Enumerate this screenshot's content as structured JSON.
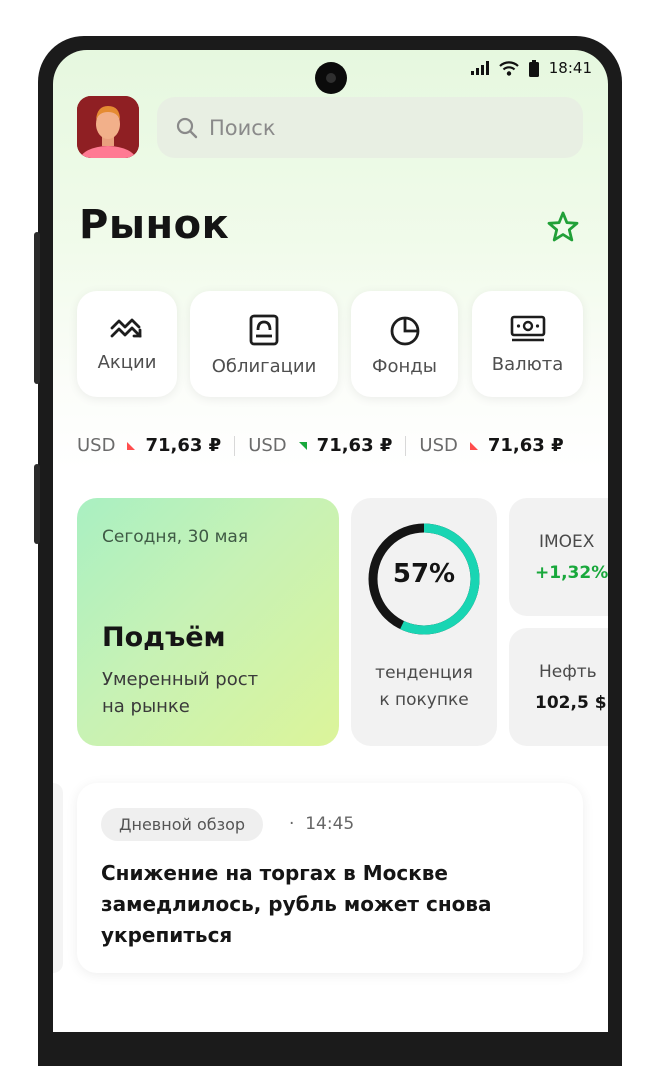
{
  "status_bar": {
    "time": "18:41",
    "icons": [
      "signal-icon",
      "wifi-icon",
      "battery-icon"
    ]
  },
  "search": {
    "placeholder": "Поиск"
  },
  "page": {
    "title": "Рынок"
  },
  "categories": [
    {
      "label": "Акции",
      "icon": "stocks-icon"
    },
    {
      "label": "Облигации",
      "icon": "bonds-icon"
    },
    {
      "label": "Фонды",
      "icon": "funds-icon"
    },
    {
      "label": "Валюта",
      "icon": "currency-icon"
    }
  ],
  "ticker": [
    {
      "currency": "USD",
      "value": "71,63 ₽",
      "direction": "down"
    },
    {
      "currency": "USD",
      "value": "71,63 ₽",
      "direction": "up"
    },
    {
      "currency": "USD",
      "value": "71,63 ₽",
      "direction": "down"
    }
  ],
  "today_card": {
    "date": "Сегодня, 30 мая",
    "headline": "Подъём",
    "line1": "Умеренный рост",
    "line2": "на рынке"
  },
  "tendency_card": {
    "value": "57%",
    "fraction": 0.57,
    "line1": "тенденция",
    "line2": "к покупке"
  },
  "index_cards": [
    {
      "name": "IMOEX",
      "value": "+1,32%"
    },
    {
      "name": "Нефть",
      "value": "102,5 $"
    }
  ],
  "news": {
    "tag": "Дневной обзор",
    "time": "14:45",
    "title": "Снижение на торгах в Москве замедлилось, рубль может снова укрепиться"
  },
  "colors": {
    "accent_green": "#21a038",
    "positive": "#19a83c",
    "negative": "#ff4d4d",
    "gauge_teal": "#19d5b3",
    "gauge_dark": "#151515"
  }
}
